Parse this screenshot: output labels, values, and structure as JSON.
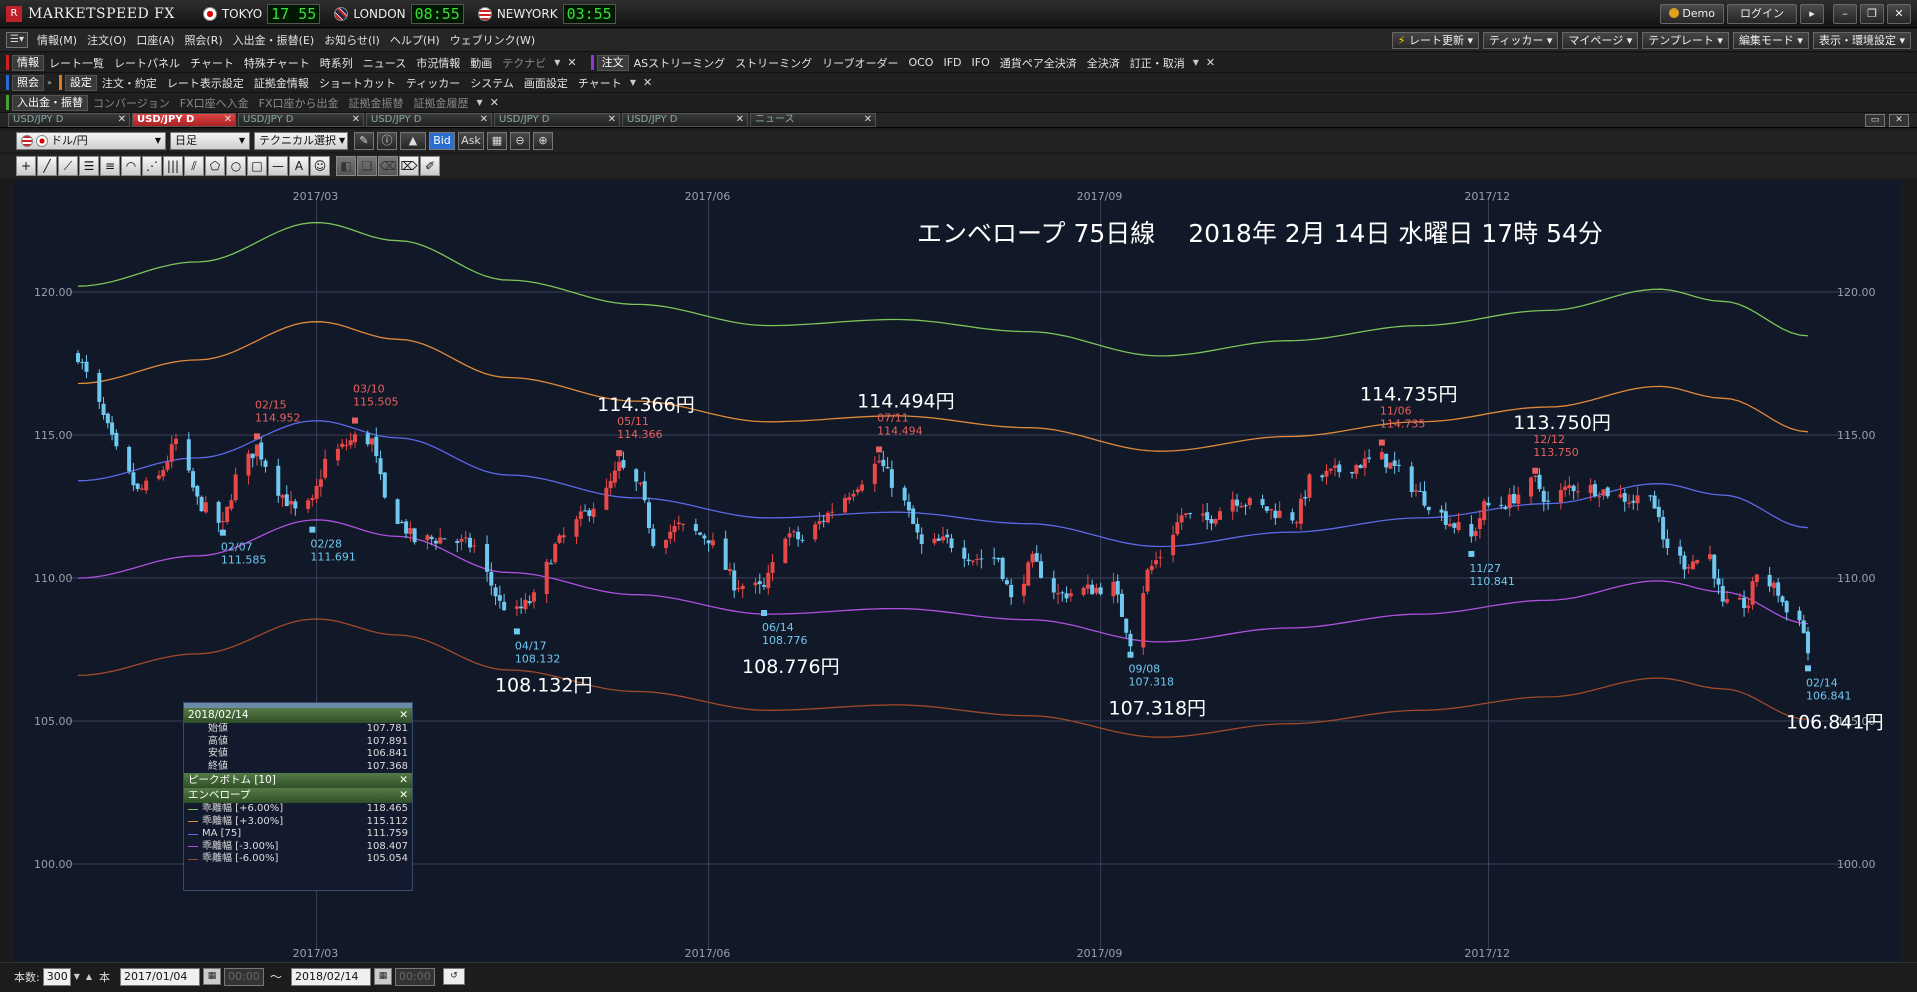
{
  "app": {
    "logo_text": "MARKETSPEED FX",
    "clocks": [
      {
        "city": "TOKYO",
        "time": "17 55"
      },
      {
        "city": "LONDON",
        "time": "08:55"
      },
      {
        "city": "NEWYORK",
        "time": "03:55"
      }
    ],
    "demo_label": "Demo",
    "login_label": "ログイン"
  },
  "menu": {
    "items": [
      "情報(M)",
      "注文(O)",
      "口座(A)",
      "照会(R)",
      "入出金・振替(E)",
      "お知らせ(I)",
      "ヘルプ(H)",
      "ウェブリンク(W)"
    ],
    "right": [
      "レート更新",
      "ティッカー",
      "マイページ",
      "テンプレート",
      "編集モード",
      "表示・環境設定"
    ]
  },
  "toolbar1": {
    "info_label": "情報",
    "info_items": [
      "レート一覧",
      "レートパネル",
      "チャート",
      "特殊チャート",
      "時系列",
      "ニュース",
      "市況情報",
      "動画"
    ],
    "info_dim": "テクナビ",
    "order_label": "注文",
    "order_items": [
      "ASストリーミング",
      "ストリーミング",
      "リーブオーダー",
      "OCO",
      "IFD",
      "IFO",
      "通貨ペア全決済",
      "全決済",
      "訂正・取消"
    ]
  },
  "toolbar2": {
    "inquiry_label": "照会",
    "settings_label": "設定",
    "settings_items": [
      "注文・約定",
      "レート表示設定",
      "証拠金情報",
      "ショートカット",
      "ティッカー",
      "システム",
      "画面設定",
      "チャート"
    ]
  },
  "toolbar3": {
    "cash_label": "入出金・振替",
    "cash_items": [
      "コンバージョン",
      "FX口座へ入金",
      "FX口座から出金",
      "証拠金振替",
      "証拠金履歴"
    ]
  },
  "tabs": [
    "USD/JPY D",
    "USD/JPY D",
    "USD/JPY D",
    "USD/JPY D",
    "USD/JPY D",
    "USD/JPY D",
    "ニュース"
  ],
  "controls": {
    "pair": "ドル/円",
    "timeframe": "日足",
    "technical": "テクニカル選択",
    "bid": "Bid",
    "ask": "Ask"
  },
  "bottom": {
    "count_label": "本数:",
    "count_value": "300",
    "unit": "本",
    "from_date": "2017/01/04",
    "from_time": "00:00",
    "to_date": "2018/02/14",
    "to_time": "00:00"
  },
  "panel": {
    "date": "2018/02/14",
    "ohlc": [
      {
        "k": "始値",
        "v": "107.781"
      },
      {
        "k": "高値",
        "v": "107.891"
      },
      {
        "k": "安値",
        "v": "106.841"
      },
      {
        "k": "終値",
        "v": "107.368"
      }
    ],
    "peak_label": "ピークボトム [10]",
    "env_label": "エンベロープ",
    "env_lines": [
      {
        "k": "乖離幅 [+6.00%]",
        "v": "118.465",
        "color": "#7ec35a"
      },
      {
        "k": "乖離幅 [+3.00%]",
        "v": "115.112",
        "color": "#e08a3a"
      },
      {
        "k": "MA [75]",
        "v": "111.759",
        "color": "#5a6ae8"
      },
      {
        "k": "乖離幅 [-3.00%]",
        "v": "108.407",
        "color": "#b050e0"
      },
      {
        "k": "乖離幅 [-6.00%]",
        "v": "105.054",
        "color": "#a04a2a"
      }
    ]
  },
  "chart_data": {
    "type": "candlestick",
    "title": "エンベロープ 75日線　 2018年 2月 14日 水曜日 17時 54分",
    "x_ticks": [
      "2017/03",
      "2017/06",
      "2017/09",
      "2017/12"
    ],
    "y_ticks": [
      "120.00",
      "115.00",
      "110.00",
      "105.00",
      "100.00"
    ],
    "ylim": [
      100,
      121.5
    ],
    "grid": true,
    "colors": {
      "up": "#e84848",
      "down": "#6ec8f0",
      "peak": "#e86060",
      "bottom": "#70c8f0"
    },
    "ohlc_anchors": [
      [
        "2017/01/04",
        117.8
      ],
      [
        "2017/01/09",
        116.0
      ],
      [
        "2017/01/13",
        114.4
      ],
      [
        "2017/01/18",
        113.0
      ],
      [
        "2017/01/23",
        113.5
      ],
      [
        "2017/01/27",
        114.8
      ],
      [
        "2017/02/01",
        112.7
      ],
      [
        "2017/02/07",
        111.8
      ],
      [
        "2017/02/10",
        113.5
      ],
      [
        "2017/02/15",
        114.6
      ],
      [
        "2017/02/20",
        113.1
      ],
      [
        "2017/02/24",
        112.3
      ],
      [
        "2017/02/28",
        112.6
      ],
      [
        "2017/03/03",
        114.1
      ],
      [
        "2017/03/10",
        114.9
      ],
      [
        "2017/03/14",
        114.8
      ],
      [
        "2017/03/17",
        112.7
      ],
      [
        "2017/03/24",
        111.3
      ],
      [
        "2017/03/31",
        111.4
      ],
      [
        "2017/04/07",
        111.1
      ],
      [
        "2017/04/13",
        109.1
      ],
      [
        "2017/04/17",
        108.8
      ],
      [
        "2017/04/21",
        109.3
      ],
      [
        "2017/04/26",
        111.1
      ],
      [
        "2017/05/02",
        112.1
      ],
      [
        "2017/05/08",
        113.0
      ],
      [
        "2017/05/11",
        113.9
      ],
      [
        "2017/05/16",
        113.1
      ],
      [
        "2017/05/19",
        111.3
      ],
      [
        "2017/05/25",
        111.8
      ],
      [
        "2017/06/01",
        111.4
      ],
      [
        "2017/06/07",
        109.8
      ],
      [
        "2017/06/14",
        109.6
      ],
      [
        "2017/06/19",
        111.6
      ],
      [
        "2017/06/23",
        111.3
      ],
      [
        "2017/06/30",
        112.4
      ],
      [
        "2017/07/06",
        113.3
      ],
      [
        "2017/07/11",
        114.1
      ],
      [
        "2017/07/17",
        112.6
      ],
      [
        "2017/07/21",
        111.1
      ],
      [
        "2017/07/27",
        111.3
      ],
      [
        "2017/08/02",
        110.7
      ],
      [
        "2017/08/08",
        110.7
      ],
      [
        "2017/08/11",
        109.2
      ],
      [
        "2017/08/16",
        110.6
      ],
      [
        "2017/08/22",
        109.4
      ],
      [
        "2017/08/29",
        109.6
      ],
      [
        "2017/09/04",
        109.7
      ],
      [
        "2017/09/08",
        107.8
      ],
      [
        "2017/09/12",
        110.2
      ],
      [
        "2017/09/15",
        110.8
      ],
      [
        "2017/09/20",
        112.2
      ],
      [
        "2017/09/26",
        112.0
      ],
      [
        "2017/10/02",
        112.8
      ],
      [
        "2017/10/06",
        112.6
      ],
      [
        "2017/10/12",
        112.3
      ],
      [
        "2017/10/17",
        112.1
      ],
      [
        "2017/10/20",
        113.4
      ],
      [
        "2017/10/26",
        113.7
      ],
      [
        "2017/11/01",
        114.0
      ],
      [
        "2017/11/06",
        114.2
      ],
      [
        "2017/11/10",
        113.7
      ],
      [
        "2017/11/15",
        112.9
      ],
      [
        "2017/11/20",
        112.2
      ],
      [
        "2017/11/27",
        111.4
      ],
      [
        "2017/11/30",
        112.5
      ],
      [
        "2017/12/05",
        112.6
      ],
      [
        "2017/12/12",
        113.4
      ],
      [
        "2017/12/15",
        112.6
      ],
      [
        "2017/12/20",
        113.2
      ],
      [
        "2017/12/27",
        113.1
      ],
      [
        "2018/01/04",
        112.7
      ],
      [
        "2018/01/08",
        113.1
      ],
      [
        "2018/01/11",
        111.3
      ],
      [
        "2018/01/16",
        110.5
      ],
      [
        "2018/01/22",
        110.8
      ],
      [
        "2018/01/25",
        109.0
      ],
      [
        "2018/01/31",
        109.1
      ],
      [
        "2018/02/02",
        110.2
      ],
      [
        "2018/02/07",
        109.5
      ],
      [
        "2018/02/09",
        108.8
      ],
      [
        "2018/02/12",
        108.7
      ],
      [
        "2018/02/14",
        107.4
      ]
    ],
    "envelope_ma75": [
      [
        "2017/01/04",
        113.4
      ],
      [
        "2017/02/01",
        114.2
      ],
      [
        "2017/03/01",
        115.5
      ],
      [
        "2017/03/20",
        114.9
      ],
      [
        "2017/04/15",
        113.6
      ],
      [
        "2017/05/15",
        112.8
      ],
      [
        "2017/06/15",
        112.1
      ],
      [
        "2017/07/15",
        112.3
      ],
      [
        "2017/08/15",
        111.9
      ],
      [
        "2017/09/15",
        111.1
      ],
      [
        "2017/10/15",
        111.6
      ],
      [
        "2017/11/15",
        112.1
      ],
      [
        "2017/12/15",
        112.6
      ],
      [
        "2018/01/10",
        113.3
      ],
      [
        "2018/01/25",
        112.9
      ],
      [
        "2018/02/14",
        111.76
      ]
    ],
    "envelope_offsets_pct": [
      6,
      3,
      0,
      -3,
      -6
    ],
    "envelope_colors": [
      "#7ec35a",
      "#e08a3a",
      "#5a6ae8",
      "#b050e0",
      "#a04a2a"
    ],
    "peaks": [
      {
        "date": "02/15",
        "price": "114.952",
        "big": ""
      },
      {
        "date": "03/10",
        "price": "115.505",
        "big": ""
      },
      {
        "date": "05/11",
        "price": "114.366",
        "big": "114.366円"
      },
      {
        "date": "07/11",
        "price": "114.494",
        "big": "114.494円"
      },
      {
        "date": "11/06",
        "price": "114.735",
        "big": "114.735円"
      },
      {
        "date": "12/12",
        "price": "113.750",
        "big": "113.750円"
      }
    ],
    "bottoms": [
      {
        "date": "02/07",
        "price": "111.585",
        "big": ""
      },
      {
        "date": "02/28",
        "price": "111.691",
        "big": ""
      },
      {
        "date": "04/17",
        "price": "108.132",
        "big": "108.132円"
      },
      {
        "date": "06/14",
        "price": "108.776",
        "big": "108.776円"
      },
      {
        "date": "09/08",
        "price": "107.318",
        "big": "107.318円"
      },
      {
        "date": "11/27",
        "price": "110.841",
        "big": ""
      },
      {
        "date": "02/14",
        "price": "106.841",
        "big": "106.841円"
      }
    ]
  }
}
